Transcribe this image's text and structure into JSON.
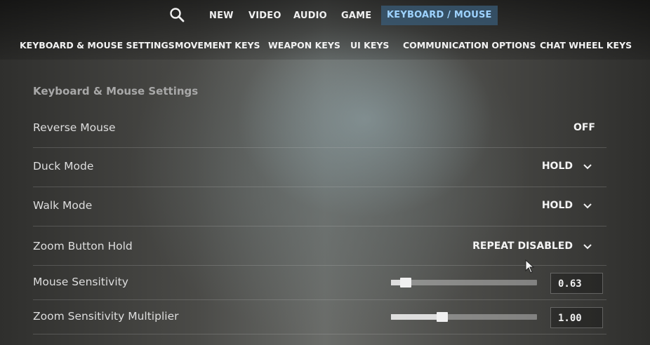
{
  "top_nav": {
    "search_icon": "search-icon",
    "tabs": [
      "NEW",
      "VIDEO",
      "AUDIO",
      "GAME",
      "KEYBOARD / MOUSE"
    ],
    "active_tab": "KEYBOARD / MOUSE"
  },
  "sub_nav": {
    "tabs": [
      "KEYBOARD & MOUSE SETTINGS",
      "MOVEMENT KEYS",
      "WEAPON KEYS",
      "UI KEYS",
      "COMMUNICATION OPTIONS",
      "CHAT WHEEL KEYS"
    ]
  },
  "section": {
    "title": "Keyboard & Mouse Settings"
  },
  "settings": {
    "reverse_mouse": {
      "label": "Reverse Mouse",
      "value": "OFF"
    },
    "duck_mode": {
      "label": "Duck Mode",
      "value": "HOLD"
    },
    "walk_mode": {
      "label": "Walk Mode",
      "value": "HOLD"
    },
    "zoom_button_hold": {
      "label": "Zoom Button Hold",
      "value": "REPEAT DISABLED"
    },
    "mouse_sensitivity": {
      "label": "Mouse Sensitivity",
      "value": "0.63",
      "slider_fraction": 0.1
    },
    "zoom_sensitivity_multiplier": {
      "label": "Zoom Sensitivity Multiplier",
      "value": "1.00",
      "slider_fraction": 0.35
    }
  },
  "colors": {
    "active_tab_bg": "#3a5c78",
    "active_tab_text": "#9ed3ff"
  }
}
